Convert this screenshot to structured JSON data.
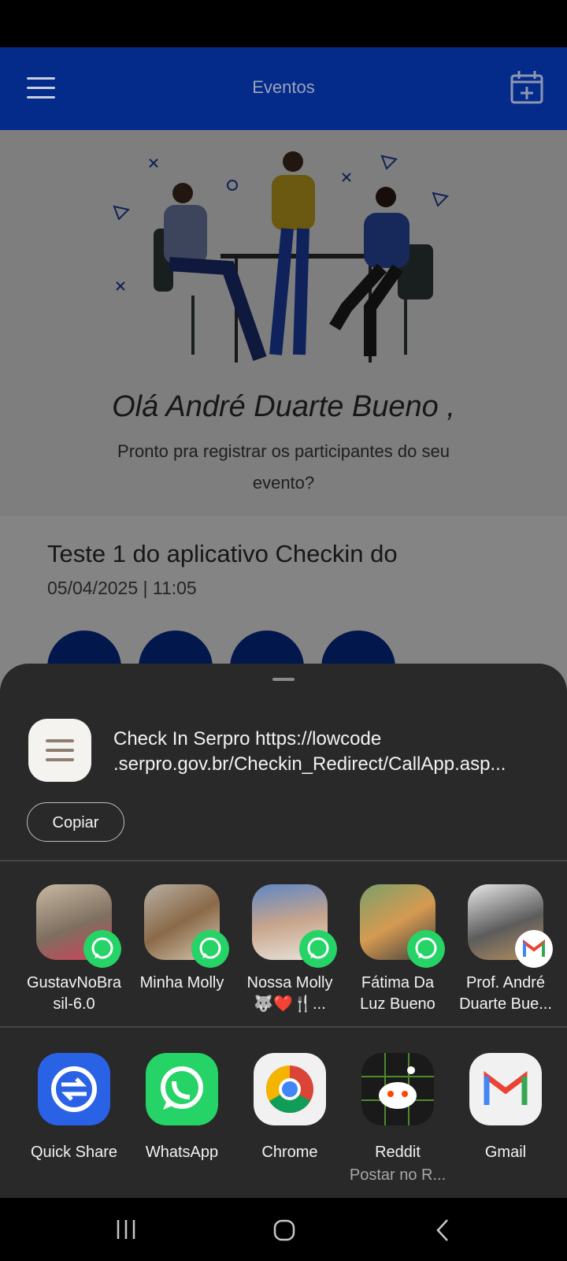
{
  "app_bar": {
    "title": "Eventos"
  },
  "hero": {
    "greeting": "Olá André Duarte Bueno ,",
    "subtext": "Pronto pra registrar os participantes do seu evento?"
  },
  "event": {
    "title": "Teste 1 do aplicativo Checkin do",
    "date": "05/04/2025 | 11:05"
  },
  "share_sheet": {
    "text_line1": "Check In Serpro https://lowcode",
    "text_line2": ".serpro.gov.br/Checkin_Redirect/CallApp.asp...",
    "copy_label": "Copiar",
    "contacts": [
      {
        "line1": "GustavNoBra",
        "line2": "sil-6.0",
        "badge": "whatsapp-icon"
      },
      {
        "line1": "Minha Molly",
        "line2": "",
        "badge": "whatsapp-icon"
      },
      {
        "line1": "Nossa Molly",
        "line2": "🐺❤️🍴...",
        "badge": "whatsapp-icon"
      },
      {
        "line1": "Fátima Da",
        "line2": "Luz Bueno",
        "badge": "whatsapp-icon"
      },
      {
        "line1": "Prof. André",
        "line2": "Duarte Bue...",
        "badge": "gmail-icon"
      }
    ],
    "apps": [
      {
        "label": "Quick Share",
        "sub": ""
      },
      {
        "label": "WhatsApp",
        "sub": ""
      },
      {
        "label": "Chrome",
        "sub": ""
      },
      {
        "label": "Reddit",
        "sub": "Postar no R..."
      },
      {
        "label": "Gmail",
        "sub": ""
      }
    ]
  },
  "colors": {
    "app_bar": "#042a8a",
    "sheet": "#292929",
    "whatsapp": "#25d366",
    "quick_share": "#2a62e6"
  }
}
